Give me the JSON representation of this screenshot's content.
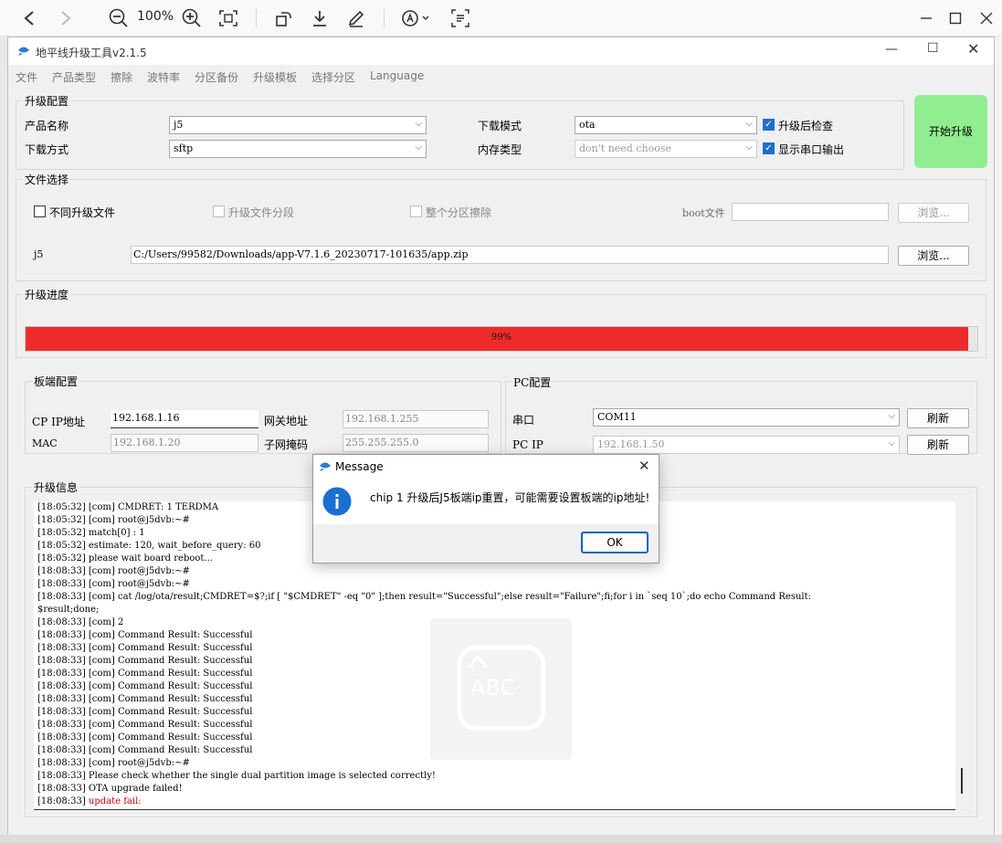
{
  "viewer": {
    "zoom": "100%"
  },
  "app": {
    "title": "地平线升级工具v2.1.5"
  },
  "menu": [
    "文件",
    "产品类型",
    "擦除",
    "波特率",
    "分区备份",
    "升级模板",
    "选择分区",
    "Language"
  ],
  "upgrade_config": {
    "title": "升级配置",
    "product_label": "产品名称",
    "product_value": "j5",
    "download_method_label": "下载方式",
    "download_method_value": "sftp",
    "download_mode_label": "下载模式",
    "download_mode_value": "ota",
    "memory_type_label": "内存类型",
    "memory_type_value": "don't need choose",
    "check_after_label": "升级后检查",
    "show_serial_label": "显示串口输出",
    "start_button": "开始升级"
  },
  "file_select": {
    "title": "文件选择",
    "diff_files_label": "不同升级文件",
    "segment_label": "升级文件分段",
    "erase_partition_label": "整个分区擦除",
    "boot_label": "boot文件",
    "browse1": "浏览...",
    "j5_label": "j5",
    "j5_path": "C:/Users/99582/Downloads/app-V7.1.6_20230717-101635/app.zip",
    "browse2": "浏览..."
  },
  "progress": {
    "title": "升级进度",
    "value": 0.99,
    "text": "99%"
  },
  "board_config": {
    "title": "板端配置",
    "cp_ip_label": "CP IP地址",
    "cp_ip_value": "192.168.1.16",
    "gateway_label": "网关地址",
    "gateway_value": "192.168.1.255",
    "mac_label": "MAC",
    "mac_value": "192.168.1.20",
    "mask_label": "子网掩码",
    "mask_value": "255.255.255.0"
  },
  "pc_config": {
    "title": "PC配置",
    "serial_label": "串口",
    "serial_value": "COM11",
    "refresh1": "刷新",
    "pc_ip_label": "PC IP",
    "pc_ip_value": "192.168.1.50",
    "refresh2": "刷新"
  },
  "upgrade_info": {
    "title": "升级信息",
    "lines": [
      "[18:05:32] [com] CMDRET: 1 TERDMA",
      "[18:05:32] [com] root@j5dvb:~#",
      "[18:05:32] match[0] : 1",
      "[18:05:32] estimate: 120, wait_before_query: 60",
      "[18:05:32] please wait board reboot...",
      "[18:08:33] [com] root@j5dvb:~#",
      "[18:08:33] [com] root@j5dvb:~#",
      "[18:08:33] [com] cat /log/ota/result;CMDRET=$?;if [ \"$CMDRET\" -eq \"0\" ];then result=\"Successful\";else result=\"Failure\";fi;for i in `seq 10`;do echo Command Result:",
      "$result;done;",
      "[18:08:33] [com] 2",
      "[18:08:33] [com] Command Result: Successful",
      "[18:08:33] [com] Command Result: Successful",
      "[18:08:33] [com] Command Result: Successful",
      "[18:08:33] [com] Command Result: Successful",
      "[18:08:33] [com] Command Result: Successful",
      "[18:08:33] [com] Command Result: Successful",
      "[18:08:33] [com] Command Result: Successful",
      "[18:08:33] [com] Command Result: Successful",
      "[18:08:33] [com] Command Result: Successful",
      "[18:08:33] [com] Command Result: Successful",
      "[18:08:33] [com] root@j5dvb:~#",
      "[18:08:33] Please check whether the single dual partition image is selected correctly!",
      "[18:08:33] OTA upgrade failed!"
    ],
    "last_prefix": "[18:08:33] ",
    "last_error": "update fail:"
  },
  "dialog": {
    "title": "Message",
    "message": "chip 1 升级后J5板端ip重置，可能需要设置板端的ip地址!",
    "ok": "OK"
  },
  "colors": {
    "progress": "#ee2b2b",
    "start_button": "#90ee90",
    "accent": "#1e70c8"
  }
}
